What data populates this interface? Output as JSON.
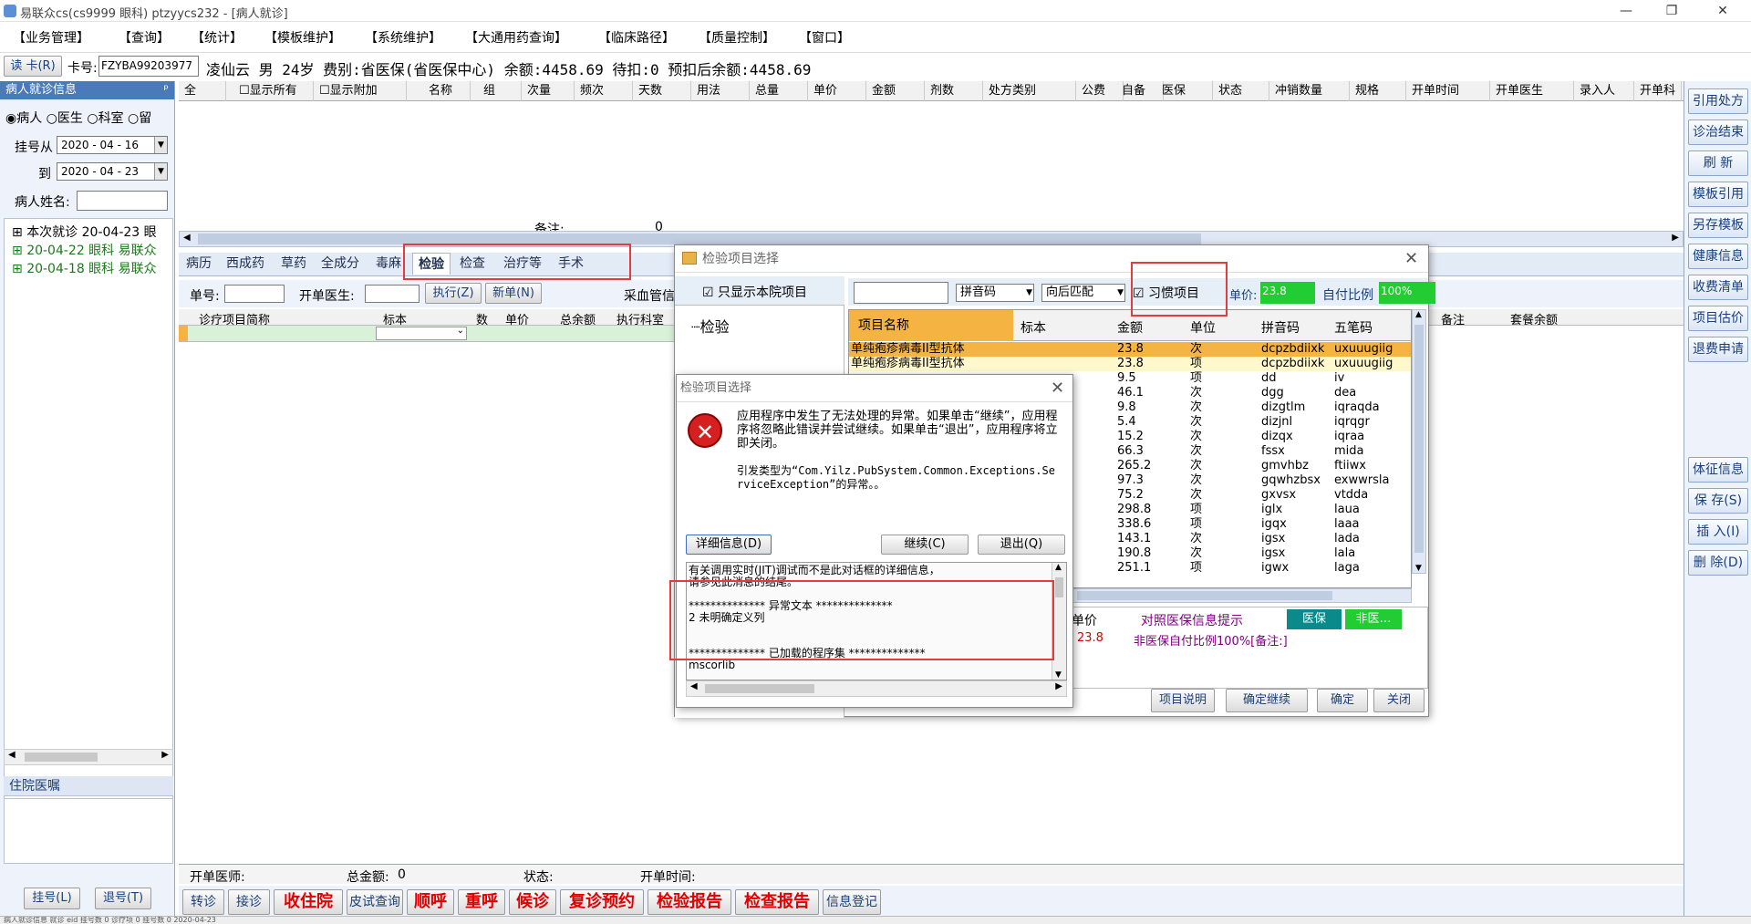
{
  "window": {
    "title": "易联众cs(cs9999 眼科) ptzyycs232 - [病人就诊]",
    "min": "—",
    "max": "❐",
    "close": "✕"
  },
  "menu": [
    "【业务管理】",
    "【查询】",
    "【统计】",
    "【模板维护】",
    "【系统维护】",
    "【大通用药查询】",
    "【临床路径】",
    "【质量控制】",
    "【窗口】"
  ],
  "patient": {
    "read_card": "读 卡(R)",
    "card_label": "卡号:",
    "card_no": "FZYBA99203977",
    "info": "凌仙云 男 24岁 费别:省医保(省医保中心) 余额:4458.69 待扣:0 预扣后余额:4458.69"
  },
  "left": {
    "header": "病人就诊信息",
    "pin": "ᵖ",
    "radios": [
      "病人",
      "医生",
      "科室",
      "留"
    ],
    "date_from_label": "挂号从",
    "date_from": "2020 - 04 - 16",
    "date_to_label": "到",
    "date_to": "2020 - 04 - 23",
    "name_label": "病人姓名:",
    "tree": [
      "本次就诊 20-04-23 眼",
      "20-04-22 眼科 易联众",
      "20-04-18 眼科 易联众"
    ],
    "inpatient_header": "住院医嘱",
    "reg_btn": "挂号(L)",
    "unreg_btn": "退号(T)"
  },
  "main_grid": {
    "headers": [
      "全",
      "显示所有",
      "显示附加",
      "名称",
      "组",
      "次量",
      "频次",
      "天数",
      "用法",
      "总量",
      "单价",
      "金额",
      "剂数",
      "处方类别",
      "公费",
      "自备",
      "医保",
      "状态",
      "冲销数量",
      "规格",
      "开单时间",
      "开单医生",
      "录入人",
      "开单科"
    ],
    "note_label": "备注:",
    "note_value": "0"
  },
  "tabs": [
    "病历",
    "西成药",
    "草药",
    "全成分",
    "毒麻",
    "检验",
    "检查",
    "治疗等",
    "手术"
  ],
  "lab_form": {
    "order_label": "单号:",
    "doctor_label": "开单医生:",
    "exec_btn": "执行(Z)",
    "new_btn": "新单(N)",
    "blood_label": "采血管信",
    "headers": [
      "诊疗项目简称",
      "标本",
      "数",
      "单价",
      "总余额",
      "执行科室"
    ],
    "extra_headers": [
      "备注",
      "套餐余额"
    ]
  },
  "right_buttons": [
    "引用处方",
    "诊治结束",
    "刷 新",
    "模板引用",
    "另存模板",
    "健康信息",
    "收费清单",
    "项目估价",
    "退费申请",
    "体征信息",
    "保 存(S)",
    "插 入(I)",
    "删 除(D)"
  ],
  "footer": {
    "doctor_label": "开单医师:",
    "total_label": "总金额:",
    "total_value": "0",
    "status_label": "状态:",
    "time_label": "开单时间:"
  },
  "bottom_buttons": [
    {
      "label": "转诊",
      "red": false
    },
    {
      "label": "接诊",
      "red": false
    },
    {
      "label": "收住院",
      "red": true
    },
    {
      "label": "皮试查询",
      "red": false
    },
    {
      "label": "顺呼",
      "red": true
    },
    {
      "label": "重呼",
      "red": true
    },
    {
      "label": "候诊",
      "red": true
    },
    {
      "label": "复诊预约",
      "red": true
    },
    {
      "label": "检验报告",
      "red": true
    },
    {
      "label": "检查报告",
      "red": true
    },
    {
      "label": "信息登记",
      "red": false
    }
  ],
  "lab_dialog": {
    "title": "检验项目选择",
    "only_local": "只显示本院项目",
    "tree_root": "检验",
    "search_mode": "拼音码",
    "match_mode": "向后匹配",
    "habit": "习惯项目",
    "price_label": "单价:",
    "price_value": "23.8",
    "ratio_label": "自付比例",
    "ratio_value": "100%",
    "headers": [
      "项目名称",
      "标本",
      "金额",
      "单位",
      "拼音码",
      "五笔码"
    ],
    "rows": [
      [
        "单纯疱疹病毒II型抗体",
        "",
        "23.8",
        "次",
        "dcpzbdiixk",
        "uxuuugiig"
      ],
      [
        "单纯疱疹病毒II型抗体",
        "",
        "23.8",
        "项",
        "dcpzbdiixk",
        "uxuuugiig"
      ],
      [
        "",
        "",
        "9.5",
        "项",
        "dd",
        "iv"
      ],
      [
        "",
        "",
        "46.1",
        "次",
        "dgg",
        "dea"
      ],
      [
        "",
        "",
        "9.8",
        "次",
        "dizgtlm",
        "iqraqda"
      ],
      [
        "",
        "",
        "5.4",
        "次",
        "dizjnl",
        "iqrqgr"
      ],
      [
        "",
        "",
        "15.2",
        "次",
        "dizqx",
        "iqraa"
      ],
      [
        "",
        "",
        "66.3",
        "次",
        "fssx",
        "mida"
      ],
      [
        "",
        "",
        "265.2",
        "次",
        "gmvhbz",
        "ftiiwx"
      ],
      [
        "",
        "",
        "97.3",
        "次",
        "gqwhzbsx",
        "exwwrsla"
      ],
      [
        "",
        "",
        "75.2",
        "次",
        "gxvsx",
        "vtdda"
      ],
      [
        "",
        "",
        "298.8",
        "项",
        "iglx",
        "laua"
      ],
      [
        "",
        "",
        "338.6",
        "项",
        "igqx",
        "laaa"
      ],
      [
        "",
        "",
        "143.1",
        "次",
        "igsx",
        "lada"
      ],
      [
        "",
        "",
        "190.8",
        "次",
        "igsx",
        "lala"
      ],
      [
        "",
        "",
        "251.1",
        "项",
        "igwx",
        "laga"
      ]
    ],
    "price_col": "单价",
    "med_info": "对照医保信息提示",
    "med_btn": "医保",
    "nonmed_btn": "非医…",
    "price_val2": "23.8",
    "nonmed_text": "非医保自付比例100%[备注:]",
    "btn_desc": "项目说明",
    "btn_confirm_cont": "确定继续",
    "btn_ok": "确定",
    "btn_close": "关闭"
  },
  "error_dialog": {
    "title": "检验项目选择",
    "message": "应用程序中发生了无法处理的异常。如果单击“继续”，应用程序将忽略此错误并尝试继续。如果单击“退出”，应用程序将立即关闭。",
    "type_text": "引发类型为“Com.Yilz.PubSystem.Common.Exceptions.ServiceException”的异常。。",
    "details_btn": "详细信息(D)",
    "continue_btn": "继续(C)",
    "quit_btn": "退出(Q)",
    "detail_lines": [
      "有关调用实时(JIT)调试而不是此对话框的详细信息，",
      "请参见此消息的结尾。",
      "",
      "************** 异常文本 **************",
      "2    未明确定义列",
      "",
      "",
      "************** 已加载的程序集 **************",
      "mscorlib"
    ]
  },
  "status_line": "病人就诊信息   就诊 eid   挂号数 0   诊疗项 0   挂号数 0   2020-04-23"
}
